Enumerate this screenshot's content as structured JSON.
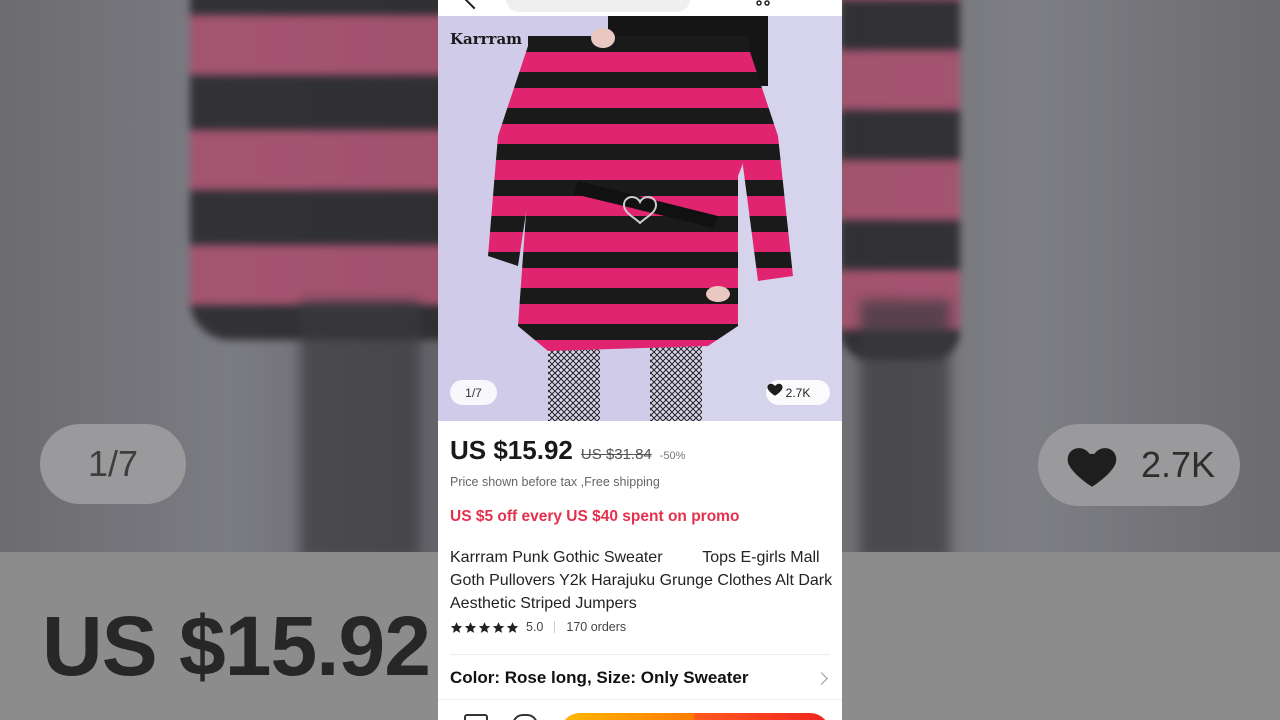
{
  "colors": {
    "accent_promo": "#e5304c",
    "add_to_cart_gradient": [
      "#ffb800",
      "#ff7a00"
    ],
    "buy_now_gradient": [
      "#ff5a1f",
      "#f1231f"
    ],
    "sweater_pink": "#e0246f",
    "sweater_black": "#1a1a1a"
  },
  "product": {
    "brand_watermark": "Karrram",
    "image_counter": "1/7",
    "likes": "2.7K",
    "price": "US $15.92",
    "original_price": "US $31.84",
    "discount": "-50%",
    "tax_note": "Price shown before tax ,Free shipping",
    "promo": "US $5 off every US $40 spent on promo",
    "title": "Karrram Punk Gothic Sweater         Tops E-girls Mall Goth Pullovers Y2k Harajuku Grunge Clothes Alt Dark Aesthetic Striped Jumpers",
    "rating": "5.0",
    "orders": "170 orders",
    "variant": "Color: Rose long, Size: Only Sweater"
  },
  "backdrop": {
    "counter": "1/7",
    "likes": "2.7K",
    "price": "US $15.92"
  },
  "icons": {
    "heart": "heart-icon",
    "star": "star-icon",
    "chevron": "chevron-right-icon",
    "back": "back-arrow-icon",
    "cart": "cart-icon",
    "store": "store-icon",
    "chat": "chat-icon"
  }
}
